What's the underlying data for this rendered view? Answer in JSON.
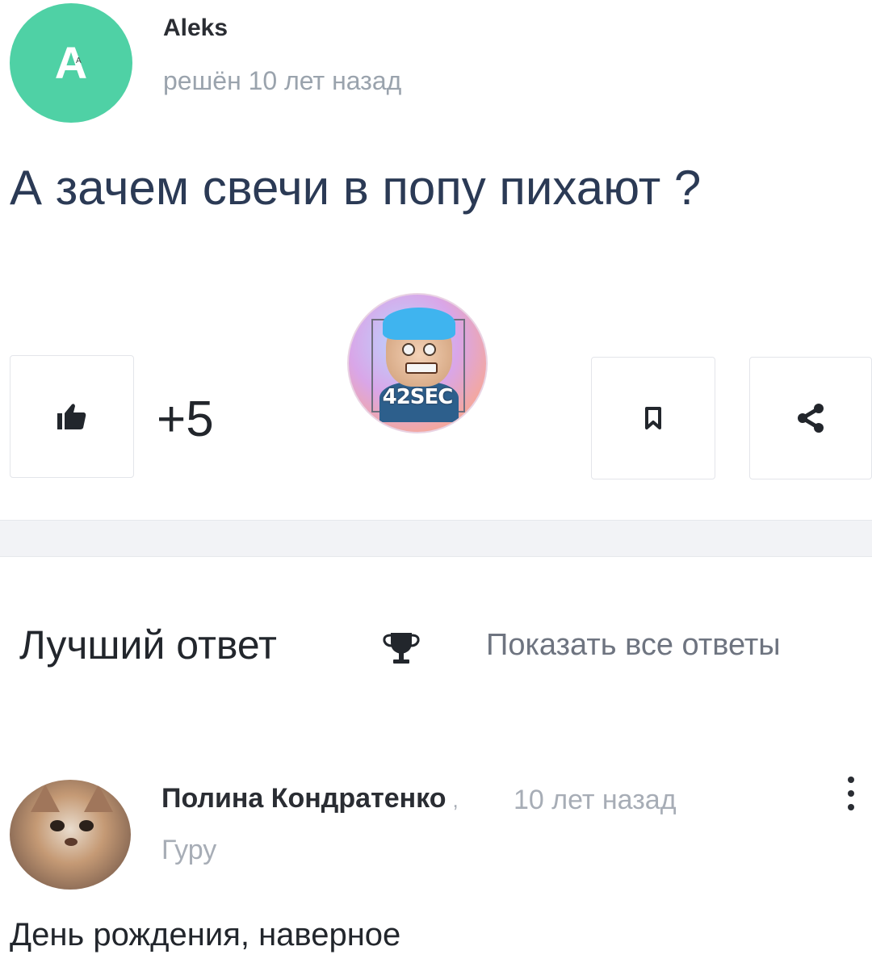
{
  "question": {
    "author": {
      "avatar_letter": "A",
      "avatar_small_text": "A",
      "name": "Aleks",
      "meta": "решён 10 лет назад",
      "avatar_color": "#4fd1a5"
    },
    "text": "А зачем свечи в попу пихают ?",
    "votes": "+5",
    "icons": {
      "like": "thumbs-up-icon",
      "bookmark": "bookmark-icon",
      "share": "share-icon"
    }
  },
  "watermark": {
    "text": "42SEC"
  },
  "best_answer": {
    "title": "Лучший ответ",
    "trophy_icon": "trophy-icon",
    "show_all_label": "Показать все ответы",
    "author": {
      "name": "Полина Кондратенко",
      "separator": ",",
      "time": "10 лет назад",
      "rank": "Гуру"
    },
    "more_icon": "more-vertical-icon",
    "text": "День рождения, наверное"
  }
}
